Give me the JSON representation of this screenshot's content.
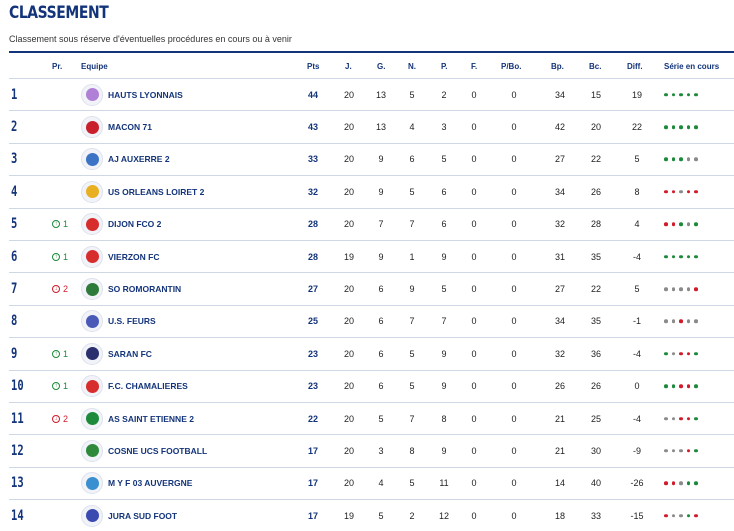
{
  "title": "CLASSEMENT",
  "subtitle": "Classement sous réserve d'éventuelles procédures en cours ou à venir",
  "headers": {
    "pr": "Pr.",
    "team": "Equipe",
    "pts": "Pts",
    "j": "J.",
    "g": "G.",
    "n": "N.",
    "p": "P.",
    "f": "F.",
    "pbo": "P/Bo.",
    "bp": "Bp.",
    "bc": "Bc.",
    "diff": "Diff.",
    "series": "Série en cours"
  },
  "colors": {
    "win": "#1c8a3a",
    "draw": "#8a8a8a",
    "loss": "#d11a2a",
    "brand": "#13347a"
  },
  "rows": [
    {
      "rank": "1",
      "evo": "",
      "evo_dir": "",
      "team": "HAUTS LYONNAIS",
      "pts": "44",
      "j": "20",
      "g": "13",
      "n": "5",
      "p": "2",
      "f": "0",
      "pbo": "0",
      "bp": "34",
      "bc": "15",
      "diff": "19",
      "series": [
        "W",
        "W",
        "W",
        "W",
        "W"
      ],
      "logo_color": "#b07fd6"
    },
    {
      "rank": "2",
      "evo": "",
      "evo_dir": "",
      "team": "MACON 71",
      "pts": "43",
      "j": "20",
      "g": "13",
      "n": "4",
      "p": "3",
      "f": "0",
      "pbo": "0",
      "bp": "42",
      "bc": "20",
      "diff": "22",
      "series": [
        "W",
        "W",
        "W",
        "W",
        "W"
      ],
      "logo_color": "#c8202c"
    },
    {
      "rank": "3",
      "evo": "",
      "evo_dir": "",
      "team": "AJ AUXERRE 2",
      "pts": "33",
      "j": "20",
      "g": "9",
      "n": "6",
      "p": "5",
      "f": "0",
      "pbo": "0",
      "bp": "27",
      "bc": "22",
      "diff": "5",
      "series": [
        "W",
        "W",
        "W",
        "D",
        "D"
      ],
      "logo_color": "#3b74c4"
    },
    {
      "rank": "4",
      "evo": "",
      "evo_dir": "",
      "team": "US ORLEANS LOIRET 2",
      "pts": "32",
      "j": "20",
      "g": "9",
      "n": "5",
      "p": "6",
      "f": "0",
      "pbo": "0",
      "bp": "34",
      "bc": "26",
      "diff": "8",
      "series": [
        "L",
        "L",
        "D",
        "L",
        "L"
      ],
      "logo_color": "#e8b021"
    },
    {
      "rank": "5",
      "evo": "1",
      "evo_dir": "up",
      "team": "DIJON FCO 2",
      "pts": "28",
      "j": "20",
      "g": "7",
      "n": "7",
      "p": "6",
      "f": "0",
      "pbo": "0",
      "bp": "32",
      "bc": "28",
      "diff": "4",
      "series": [
        "L",
        "L",
        "W",
        "D",
        "W"
      ],
      "logo_color": "#d72d2d"
    },
    {
      "rank": "6",
      "evo": "1",
      "evo_dir": "up",
      "team": "VIERZON FC",
      "pts": "28",
      "j": "19",
      "g": "9",
      "n": "1",
      "p": "9",
      "f": "0",
      "pbo": "0",
      "bp": "31",
      "bc": "35",
      "diff": "-4",
      "series": [
        "W",
        "W",
        "W",
        "W",
        "W"
      ],
      "logo_color": "#d72d2d"
    },
    {
      "rank": "7",
      "evo": "2",
      "evo_dir": "down",
      "team": "SO ROMORANTIN",
      "pts": "27",
      "j": "20",
      "g": "6",
      "n": "9",
      "p": "5",
      "f": "0",
      "pbo": "0",
      "bp": "27",
      "bc": "22",
      "diff": "5",
      "series": [
        "D",
        "D",
        "D",
        "D",
        "L"
      ],
      "logo_color": "#2e7a3a"
    },
    {
      "rank": "8",
      "evo": "",
      "evo_dir": "",
      "team": "U.S. FEURS",
      "pts": "25",
      "j": "20",
      "g": "6",
      "n": "7",
      "p": "7",
      "f": "0",
      "pbo": "0",
      "bp": "34",
      "bc": "35",
      "diff": "-1",
      "series": [
        "D",
        "D",
        "L",
        "D",
        "D"
      ],
      "logo_color": "#4a59b8"
    },
    {
      "rank": "9",
      "evo": "1",
      "evo_dir": "up",
      "team": "SARAN FC",
      "pts": "23",
      "j": "20",
      "g": "6",
      "n": "5",
      "p": "9",
      "f": "0",
      "pbo": "0",
      "bp": "32",
      "bc": "36",
      "diff": "-4",
      "series": [
        "W",
        "D",
        "L",
        "L",
        "W"
      ],
      "logo_color": "#2a2f6e"
    },
    {
      "rank": "10",
      "evo": "1",
      "evo_dir": "up",
      "team": "F.C. CHAMALIERES",
      "pts": "23",
      "j": "20",
      "g": "6",
      "n": "5",
      "p": "9",
      "f": "0",
      "pbo": "0",
      "bp": "26",
      "bc": "26",
      "diff": "0",
      "series": [
        "W",
        "W",
        "L",
        "L",
        "W"
      ],
      "logo_color": "#d72d2d"
    },
    {
      "rank": "11",
      "evo": "2",
      "evo_dir": "down",
      "team": "AS SAINT ETIENNE 2",
      "pts": "22",
      "j": "20",
      "g": "5",
      "n": "7",
      "p": "8",
      "f": "0",
      "pbo": "0",
      "bp": "21",
      "bc": "25",
      "diff": "-4",
      "series": [
        "D",
        "D",
        "L",
        "L",
        "W"
      ],
      "logo_color": "#1c8a3a"
    },
    {
      "rank": "12",
      "evo": "",
      "evo_dir": "",
      "team": "COSNE UCS FOOTBALL",
      "pts": "17",
      "j": "20",
      "g": "3",
      "n": "8",
      "p": "9",
      "f": "0",
      "pbo": "0",
      "bp": "21",
      "bc": "30",
      "diff": "-9",
      "series": [
        "D",
        "D",
        "D",
        "L",
        "W"
      ],
      "logo_color": "#2e8a3a"
    },
    {
      "rank": "13",
      "evo": "",
      "evo_dir": "",
      "team": "M Y F 03 AUVERGNE",
      "pts": "17",
      "j": "20",
      "g": "4",
      "n": "5",
      "p": "11",
      "f": "0",
      "pbo": "0",
      "bp": "14",
      "bc": "40",
      "diff": "-26",
      "series": [
        "L",
        "L",
        "D",
        "W",
        "W"
      ],
      "logo_color": "#3a8fd0"
    },
    {
      "rank": "14",
      "evo": "",
      "evo_dir": "",
      "team": "JURA SUD FOOT",
      "pts": "17",
      "j": "19",
      "g": "5",
      "n": "2",
      "p": "12",
      "f": "0",
      "pbo": "0",
      "bp": "18",
      "bc": "33",
      "diff": "-15",
      "series": [
        "L",
        "D",
        "D",
        "W",
        "L"
      ],
      "logo_color": "#3a4ab0"
    }
  ]
}
